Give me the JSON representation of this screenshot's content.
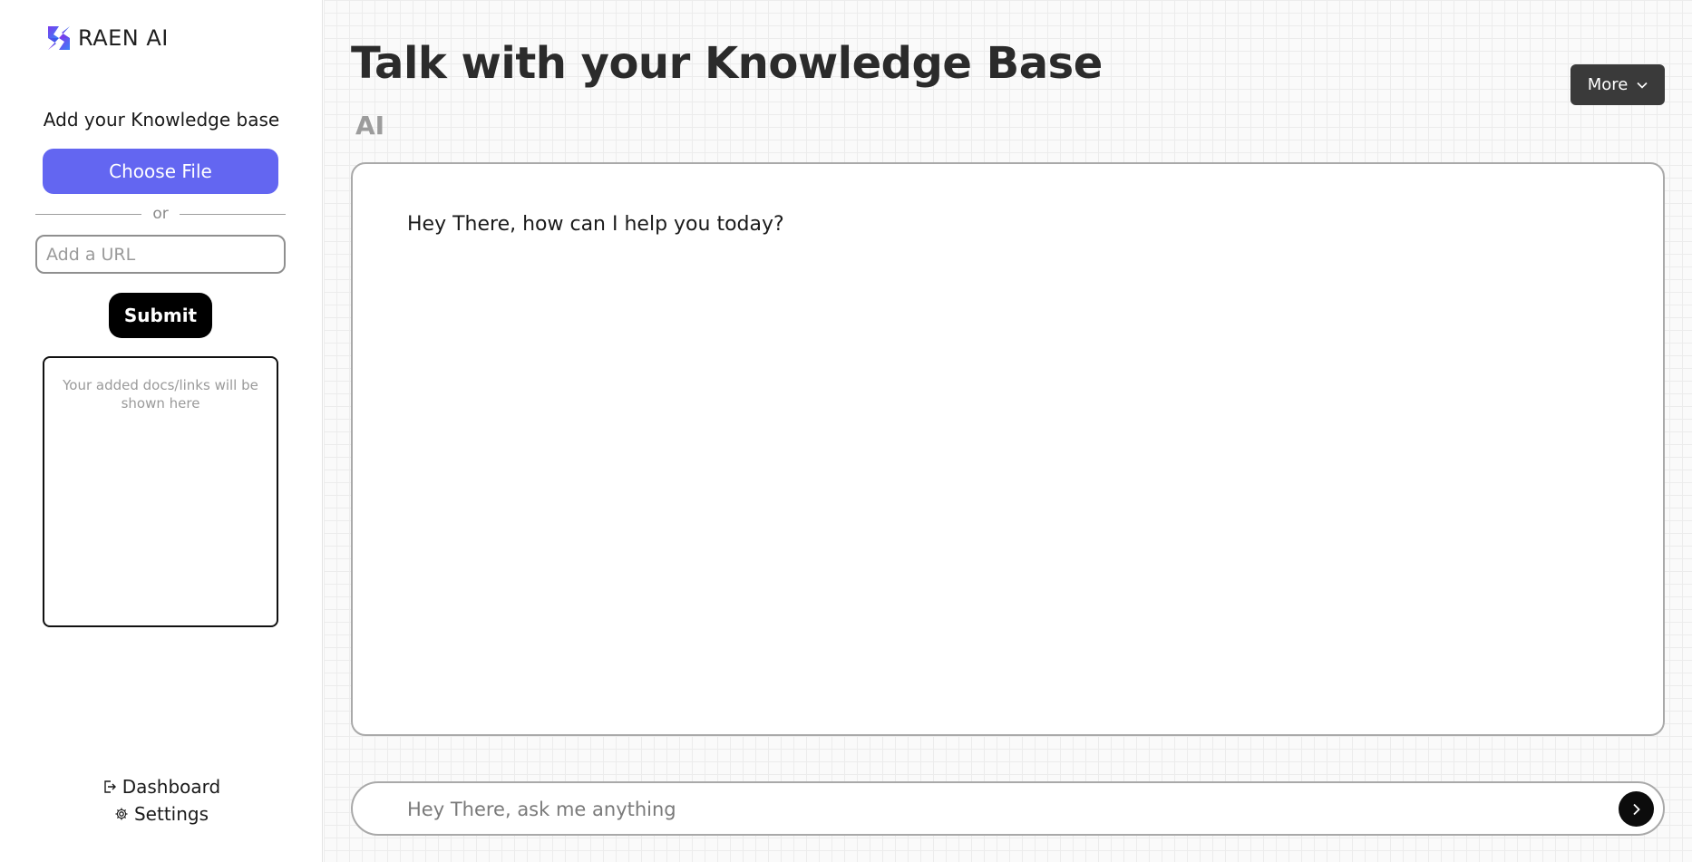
{
  "sidebar": {
    "logo_text": "RAEN AI",
    "kb_heading": "Add your Knowledge base",
    "choose_file_label": "Choose File",
    "or_label": "or",
    "url_placeholder": "Add a URL",
    "url_value": "",
    "submit_label": "Submit",
    "docs_placeholder": "Your added docs/links will be shown here",
    "nav": {
      "dashboard": {
        "label": "Dashboard",
        "icon": "logout-icon"
      },
      "settings": {
        "label": "Settings",
        "icon": "gear-icon"
      }
    }
  },
  "main": {
    "title": "Talk with your Knowledge Base",
    "ai_label": "AI",
    "more_label": "More",
    "messages": [
      {
        "sender": "AI",
        "text": "Hey There, how can I help you today?"
      }
    ],
    "input_placeholder": "Hey There, ask me anything",
    "input_value": ""
  },
  "colors": {
    "accent": "#6366f1",
    "submit": "#000000",
    "more_button": "#3a3a3a",
    "send_button": "#0c0c0c",
    "title": "#2b2b2b",
    "ai_label": "#9c9c9c"
  }
}
